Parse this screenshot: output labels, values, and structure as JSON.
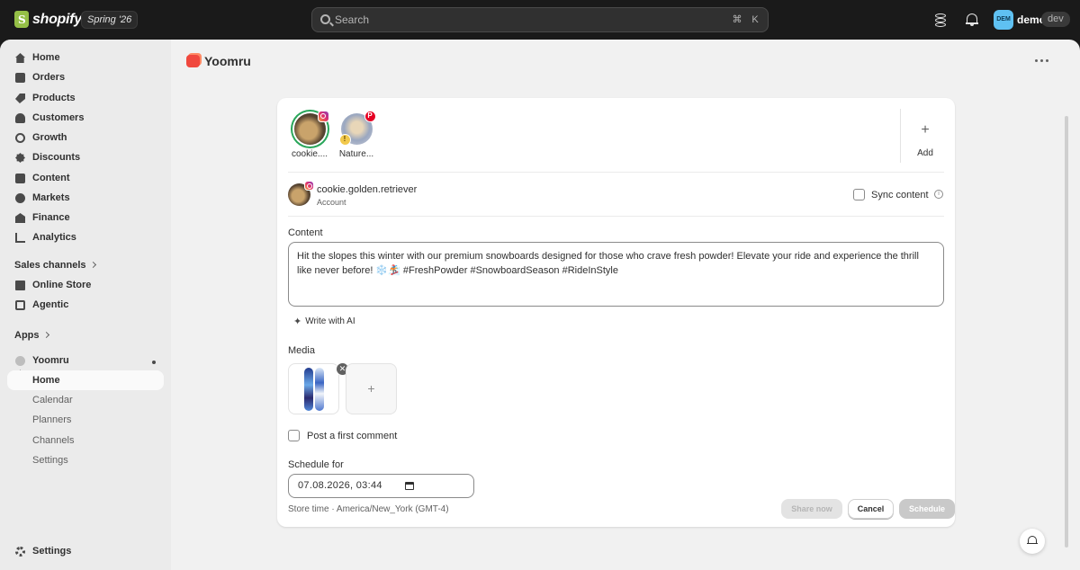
{
  "topbar": {
    "brand": "shopify",
    "edition": "Spring '26",
    "search_placeholder": "Search",
    "shortcut_keys": [
      "⌘",
      "K"
    ],
    "avatar_initials": "DEM",
    "user_name": "demo",
    "env_badge": "dev"
  },
  "sidebar": {
    "main_items": [
      {
        "label": "Home",
        "icon": "home-icon"
      },
      {
        "label": "Orders",
        "icon": "orders-icon"
      },
      {
        "label": "Products",
        "icon": "tag-icon"
      },
      {
        "label": "Customers",
        "icon": "person-icon"
      },
      {
        "label": "Growth",
        "icon": "growth-icon"
      },
      {
        "label": "Discounts",
        "icon": "discount-icon"
      },
      {
        "label": "Content",
        "icon": "content-icon"
      },
      {
        "label": "Markets",
        "icon": "globe-icon"
      },
      {
        "label": "Finance",
        "icon": "bank-icon"
      },
      {
        "label": "Analytics",
        "icon": "bar-chart-icon"
      }
    ],
    "sales_channels_label": "Sales channels",
    "channels": [
      {
        "label": "Online Store",
        "icon": "store-icon"
      },
      {
        "label": "Agentic",
        "icon": "agentic-icon"
      }
    ],
    "apps_label": "Apps",
    "app_name": "Yoomru",
    "app_subitems": [
      "Home",
      "Calendar",
      "Planners",
      "Channels",
      "Settings"
    ],
    "settings_label": "Settings"
  },
  "main": {
    "title": "Yoomru",
    "accounts": [
      {
        "label": "cookie....",
        "network": "instagram",
        "selected": true
      },
      {
        "label": "Nature...",
        "network": "pinterest",
        "warning": "!"
      }
    ],
    "add_label": "Add",
    "account_name": "cookie.golden.retriever",
    "account_sub": "Account",
    "sync_label": "Sync content",
    "info_glyph": "i",
    "content_label": "Content",
    "content_text": "Hit the slopes this winter with our premium snowboards designed for those who crave fresh powder! Elevate your ride and experience the thrill like never before! ❄️🏂 #FreshPowder #SnowboardSeason #RideInStyle",
    "ai_label": "Write with AI",
    "media_label": "Media",
    "remove_glyph": "✕",
    "add_media_glyph": "+",
    "first_comment_label": "Post a first comment",
    "schedule_label": "Schedule for",
    "schedule_value": "07.08.2026, 03:44",
    "timezone_hint": "Store time · America/New_York (GMT-4)",
    "buttons": {
      "share": "Share now",
      "cancel": "Cancel",
      "schedule": "Schedule"
    }
  },
  "colors": {
    "accent_ring": "#29a65a",
    "instagram": "#e1306c",
    "pinterest": "#e60023",
    "brand": "#95bf47"
  }
}
